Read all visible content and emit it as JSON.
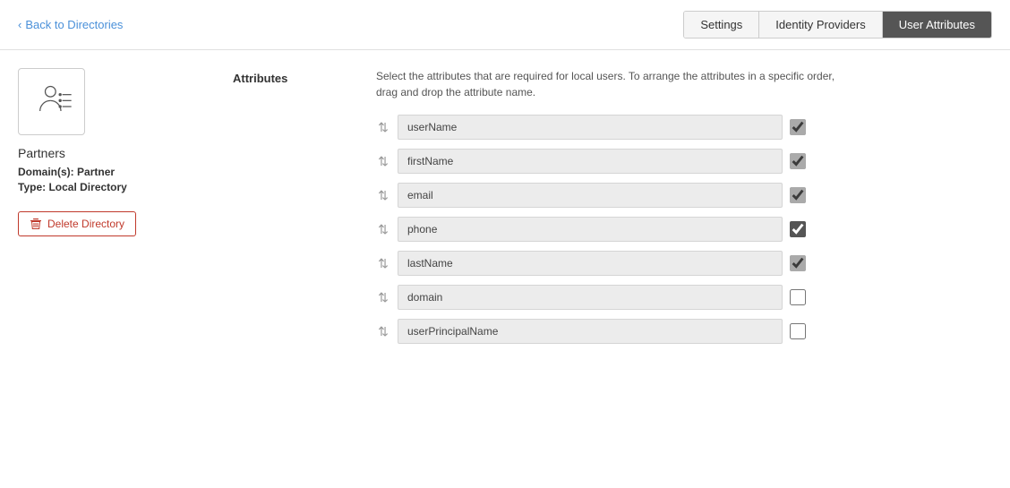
{
  "header": {
    "back_label": "Back to Directories",
    "back_chevron": "‹",
    "tabs": [
      {
        "id": "settings",
        "label": "Settings",
        "active": false
      },
      {
        "id": "identity-providers",
        "label": "Identity Providers",
        "active": false
      },
      {
        "id": "user-attributes",
        "label": "User Attributes",
        "active": true
      }
    ]
  },
  "sidebar": {
    "directory_name": "Partners",
    "domain_label": "Domain(s):",
    "domain_value": "Partner",
    "type_label": "Type:",
    "type_value": "Local Directory",
    "delete_label": "Delete Directory"
  },
  "content": {
    "attributes_label": "Attributes",
    "description_line1": "Select the attributes that are required for local users. To arrange the attributes in a specific order,",
    "description_line2": "drag and drop the attribute name.",
    "attributes": [
      {
        "name": "userName",
        "checked": true,
        "disabled": true
      },
      {
        "name": "firstName",
        "checked": true,
        "disabled": true
      },
      {
        "name": "email",
        "checked": true,
        "disabled": true
      },
      {
        "name": "phone",
        "checked": true,
        "disabled": false
      },
      {
        "name": "lastName",
        "checked": true,
        "disabled": true
      },
      {
        "name": "domain",
        "checked": false,
        "disabled": false
      },
      {
        "name": "userPrincipalName",
        "checked": false,
        "disabled": false
      }
    ]
  }
}
